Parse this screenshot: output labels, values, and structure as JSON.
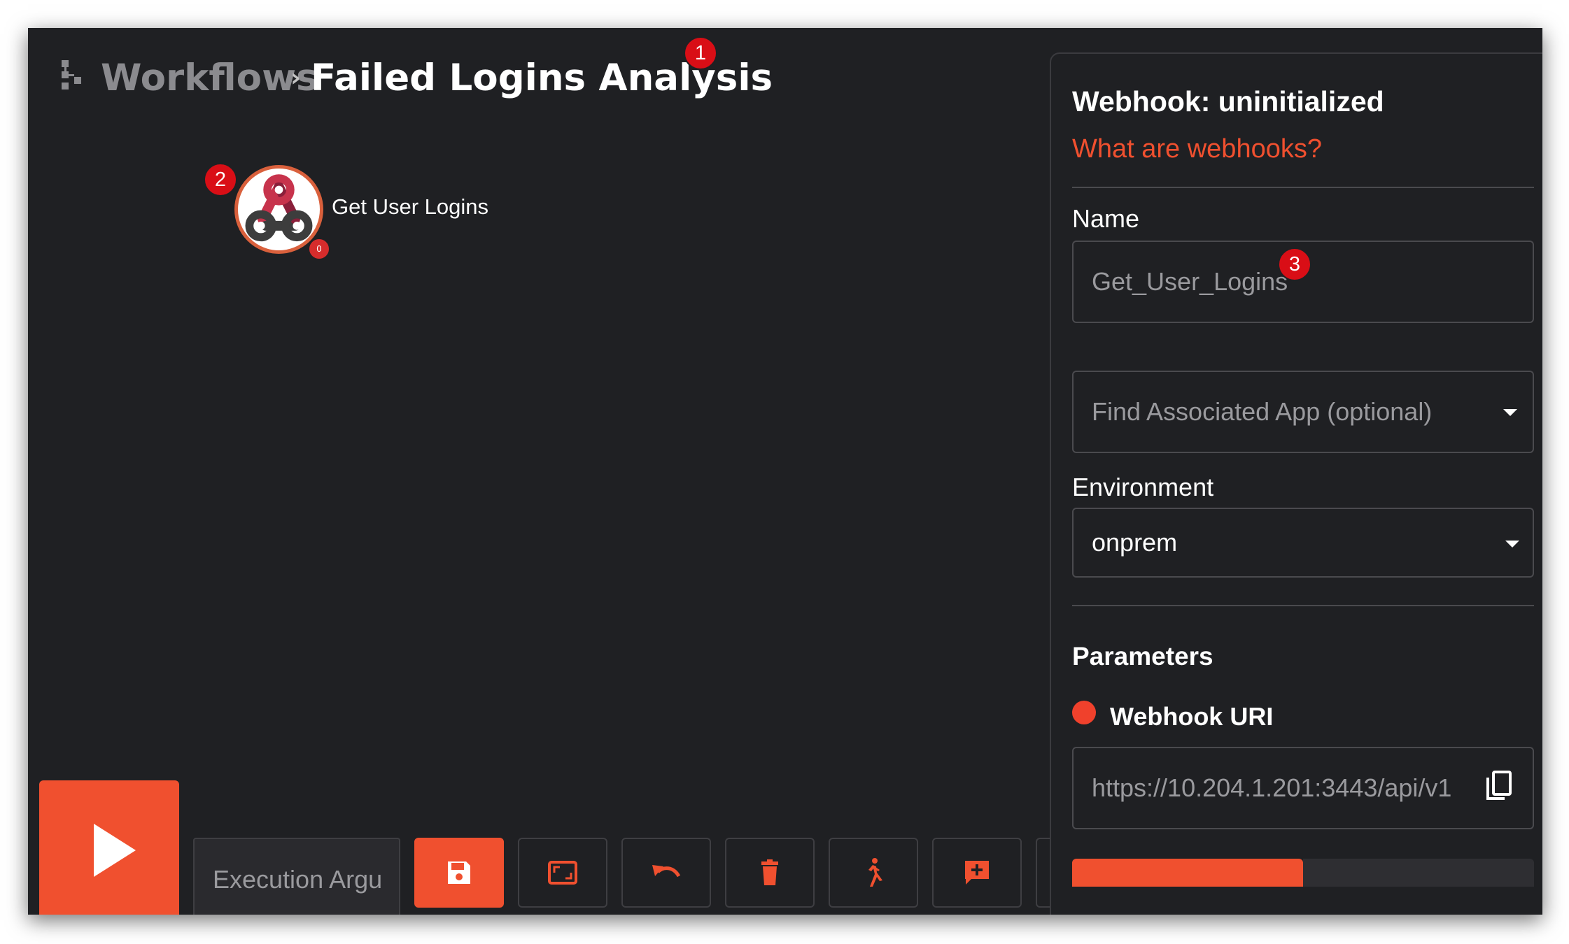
{
  "breadcrumb": {
    "icon": "workflow-tree-icon",
    "parent": "Workflows",
    "separator": "›",
    "current": "Failed Logins Analysis"
  },
  "badges": {
    "one": "1",
    "two": "2",
    "three": "3"
  },
  "node": {
    "icon": "webhook-icon",
    "label": "Get User Logins",
    "count": "0"
  },
  "toolbar": {
    "run_icon": "play-icon",
    "execution_args_placeholder": "Execution Argu",
    "buttons": [
      {
        "name": "save",
        "icon": "floppy-disk-icon"
      },
      {
        "name": "fit-view",
        "icon": "aspect-ratio-icon"
      },
      {
        "name": "undo",
        "icon": "undo-icon"
      },
      {
        "name": "delete",
        "icon": "trash-icon"
      },
      {
        "name": "run-workflow",
        "icon": "running-person-icon"
      },
      {
        "name": "add-comment",
        "icon": "comment-plus-icon"
      },
      {
        "name": "edit",
        "icon": "pencil-icon"
      },
      {
        "name": "refresh",
        "icon": "refresh-icon"
      }
    ]
  },
  "panel": {
    "title": "Webhook: uninitialized",
    "help_link": "What are webhooks?",
    "name_label": "Name",
    "name_value": "Get_User_Logins",
    "app_placeholder": "Find Associated App (optional)",
    "environment_label": "Environment",
    "environment_value": "onprem",
    "parameters_label": "Parameters",
    "webhook_uri_label": "Webhook URI",
    "webhook_uri_value": "https://10.204.1.201:3443/api/v1",
    "copy_icon": "copy-icon"
  },
  "colors": {
    "accent": "#f0502f",
    "background": "#1f2023",
    "badge": "#d90e16",
    "status_dot": "#f0412c"
  }
}
